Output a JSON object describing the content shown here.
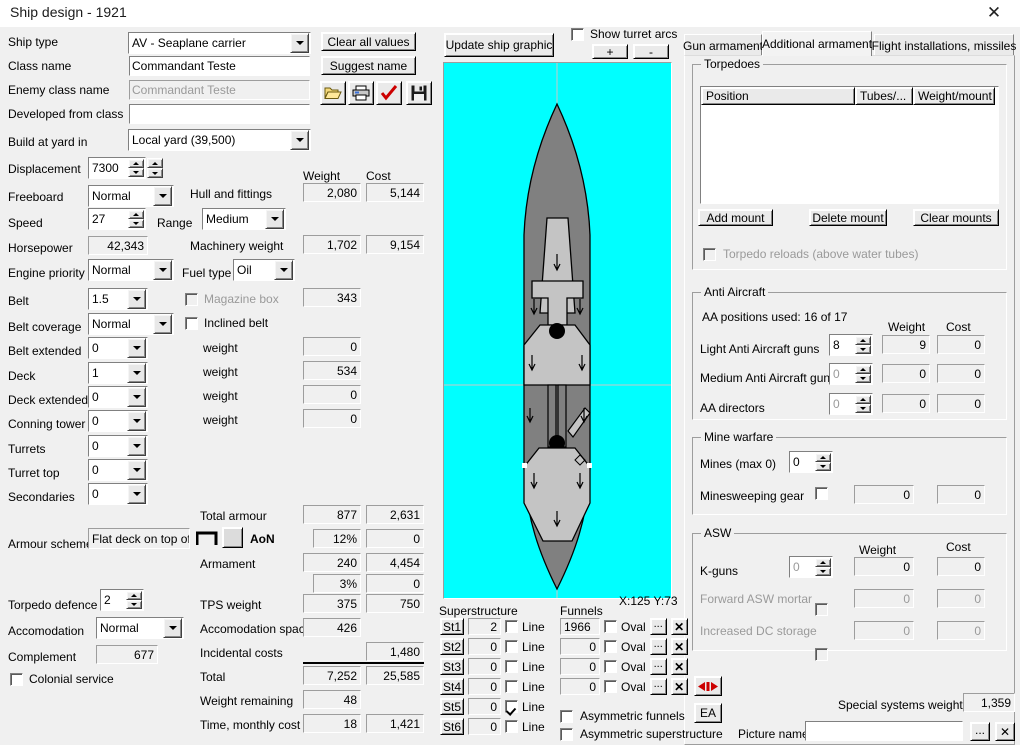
{
  "window": {
    "title": "Ship design - 1921",
    "close_icon": "✕"
  },
  "left_form": {
    "ship_type": {
      "label": "Ship type",
      "value": "AV - Seaplane carrier"
    },
    "class_name": {
      "label": "Class name",
      "value": "Commandant Teste"
    },
    "enemy_class_name": {
      "label": "Enemy class name",
      "value": "Commandant Teste"
    },
    "developed_from_class": {
      "label": "Developed from class",
      "value": ""
    },
    "build_at_yard": {
      "label": "Build at yard in",
      "value": "Local yard (39,500)"
    },
    "displacement": {
      "label": "Displacement",
      "value": "7300"
    },
    "freeboard": {
      "label": "Freeboard",
      "value": "Normal"
    },
    "speed": {
      "label": "Speed",
      "value": "27"
    },
    "range": {
      "label": "Range",
      "value": "Medium"
    },
    "horsepower": {
      "label": "Horsepower",
      "value": "42,343"
    },
    "engine_priority": {
      "label": "Engine priority",
      "value": "Normal"
    },
    "fuel_type": {
      "label": "Fuel type",
      "value": "Oil"
    },
    "belt": {
      "label": "Belt",
      "value": "1.5"
    },
    "belt_coverage": {
      "label": "Belt coverage",
      "value": "Normal"
    },
    "belt_extended": {
      "label": "Belt extended",
      "value": "0"
    },
    "deck": {
      "label": "Deck",
      "value": "1"
    },
    "deck_extended": {
      "label": "Deck extended",
      "value": "0"
    },
    "conning_tower": {
      "label": "Conning tower",
      "value": "0"
    },
    "turrets": {
      "label": "Turrets",
      "value": "0"
    },
    "turret_top": {
      "label": "Turret top",
      "value": "0"
    },
    "secondaries": {
      "label": "Secondaries",
      "value": "0"
    },
    "armour_scheme": {
      "label": "Armour scheme",
      "value": "Flat deck on top of",
      "aon_label": "AoN"
    },
    "torpedo_defence": {
      "label": "Torpedo defence",
      "value": "2"
    },
    "accomodation": {
      "label": "Accomodation",
      "value": "Normal"
    },
    "complement": {
      "label": "Complement",
      "value": "677"
    },
    "colonial_service": {
      "label": "Colonial service",
      "checked": false
    }
  },
  "weights": {
    "header_weight": "Weight",
    "header_cost": "Cost",
    "rows": [
      {
        "label": "Hull and fittings",
        "weight": "2,080",
        "cost": "5,144"
      },
      {
        "label": "Machinery weight",
        "weight": "1,702",
        "cost": "9,154"
      },
      {
        "label": "",
        "weight": "343",
        "cost": ""
      },
      {
        "label": "weight",
        "weight": "0",
        "cost": ""
      },
      {
        "label": "weight",
        "weight": "534",
        "cost": ""
      },
      {
        "label": "weight",
        "weight": "0",
        "cost": ""
      },
      {
        "label": "weight",
        "weight": "0",
        "cost": ""
      },
      {
        "label": "Total armour",
        "weight": "877",
        "cost": "2,631"
      },
      {
        "label": "",
        "weight": "12%",
        "cost": "0"
      },
      {
        "label": "Armament",
        "weight": "240",
        "cost": "4,454"
      },
      {
        "label": "",
        "weight": "3%",
        "cost": "0"
      },
      {
        "label": "TPS weight",
        "weight": "375",
        "cost": "750"
      },
      {
        "label": "Accomodation space",
        "weight": "426",
        "cost": ""
      },
      {
        "label": "Incidental costs",
        "weight": "",
        "cost": "1,480"
      },
      {
        "label": "Total",
        "weight": "7,252",
        "cost": "25,585"
      },
      {
        "label": "Weight remaining",
        "weight": "48",
        "cost": ""
      },
      {
        "label": "Time, monthly cost",
        "weight": "18",
        "cost": "1,421"
      }
    ],
    "magazine_box": {
      "label": "Magazine box",
      "checked": false
    },
    "inclined_belt": {
      "label": "Inclined belt",
      "checked": false
    }
  },
  "toolbar": {
    "clear_all_values": "Clear all values",
    "suggest_name": "Suggest name",
    "open_icon": "open-folder-icon",
    "print_icon": "printer-icon",
    "check_icon": "red-check-icon",
    "save_icon": "floppy-disk-icon"
  },
  "graphic": {
    "update_button": "Update ship graphic",
    "show_turret_arcs": {
      "label": "Show turret arcs",
      "checked": false
    },
    "zoom_in": "+",
    "zoom_out": "-",
    "coords": "X:125 Y:73",
    "bg_color": "#00ffff",
    "hull_color": "#808080",
    "deck_color": "#c0c0c0"
  },
  "tabs": [
    {
      "label": "Gun armament",
      "active": false
    },
    {
      "label": "Additional armament",
      "active": true
    },
    {
      "label": "Flight installations, missiles",
      "active": false
    }
  ],
  "torpedoes": {
    "group_label": "Torpedoes",
    "columns": [
      "Position",
      "Tubes/...",
      "Weight/mount"
    ],
    "rows": [],
    "add_mount": "Add mount",
    "delete_mount": "Delete mount",
    "clear_mounts": "Clear mounts",
    "reloads": {
      "label": "Torpedo reloads (above water tubes)",
      "checked": false,
      "disabled": true
    }
  },
  "anti_aircraft": {
    "group_label": "Anti Aircraft",
    "positions_used": "AA positions used: 16 of 17",
    "header_weight": "Weight",
    "header_cost": "Cost",
    "rows": [
      {
        "label": "Light Anti Aircraft guns",
        "value": "8",
        "weight": "9",
        "cost": "0",
        "disabled": false
      },
      {
        "label": "Medium Anti Aircraft guns",
        "value": "0",
        "weight": "0",
        "cost": "0",
        "disabled": true
      },
      {
        "label": "AA directors",
        "value": "0",
        "weight": "0",
        "cost": "0",
        "disabled": true
      }
    ]
  },
  "mine_warfare": {
    "group_label": "Mine warfare",
    "mines": {
      "label": "Mines (max 0)",
      "value": "0"
    },
    "minesweeping": {
      "label": "Minesweeping gear",
      "checked": false,
      "weight": "0",
      "cost": "0"
    }
  },
  "asw": {
    "group_label": "ASW",
    "header_weight": "Weight",
    "header_cost": "Cost",
    "kguns": {
      "label": "K-guns",
      "value": "0",
      "weight": "0",
      "cost": "0"
    },
    "forward_mortar": {
      "label": "Forward ASW mortar",
      "checked": false,
      "weight": "0",
      "cost": "0",
      "disabled": true
    },
    "dc_storage": {
      "label": "Increased DC storage",
      "checked": false,
      "weight": "0",
      "cost": "0",
      "disabled": true
    }
  },
  "superstructure": {
    "label": "Superstructure",
    "line_label": "Line",
    "rows": [
      {
        "button": "St1",
        "value": "2",
        "line": false
      },
      {
        "button": "St2",
        "value": "0",
        "line": false
      },
      {
        "button": "St3",
        "value": "0",
        "line": false
      },
      {
        "button": "St4",
        "value": "0",
        "line": false
      },
      {
        "button": "St5",
        "value": "0",
        "line": true
      },
      {
        "button": "St6",
        "value": "0",
        "line": false
      }
    ]
  },
  "funnels": {
    "label": "Funnels",
    "oval_label": "Oval",
    "rows": [
      {
        "value": "1966",
        "oval": false
      },
      {
        "value": "0",
        "oval": false
      },
      {
        "value": "0",
        "oval": false
      },
      {
        "value": "0",
        "oval": false
      }
    ],
    "asymmetric_funnels": {
      "label": "Asymmetric funnels",
      "checked": false
    },
    "asymmetric_superstructure": {
      "label": "Asymmetric superstructure",
      "checked": false
    }
  },
  "bottom_right": {
    "flip_button": "flip-horizontal-icon",
    "ea_button": "EA",
    "special_systems_weight": {
      "label": "Special systems weight",
      "value": "1,359"
    },
    "picture_name": {
      "label": "Picture name",
      "value": ""
    },
    "browse_button": "...",
    "clear_button": "✕"
  }
}
